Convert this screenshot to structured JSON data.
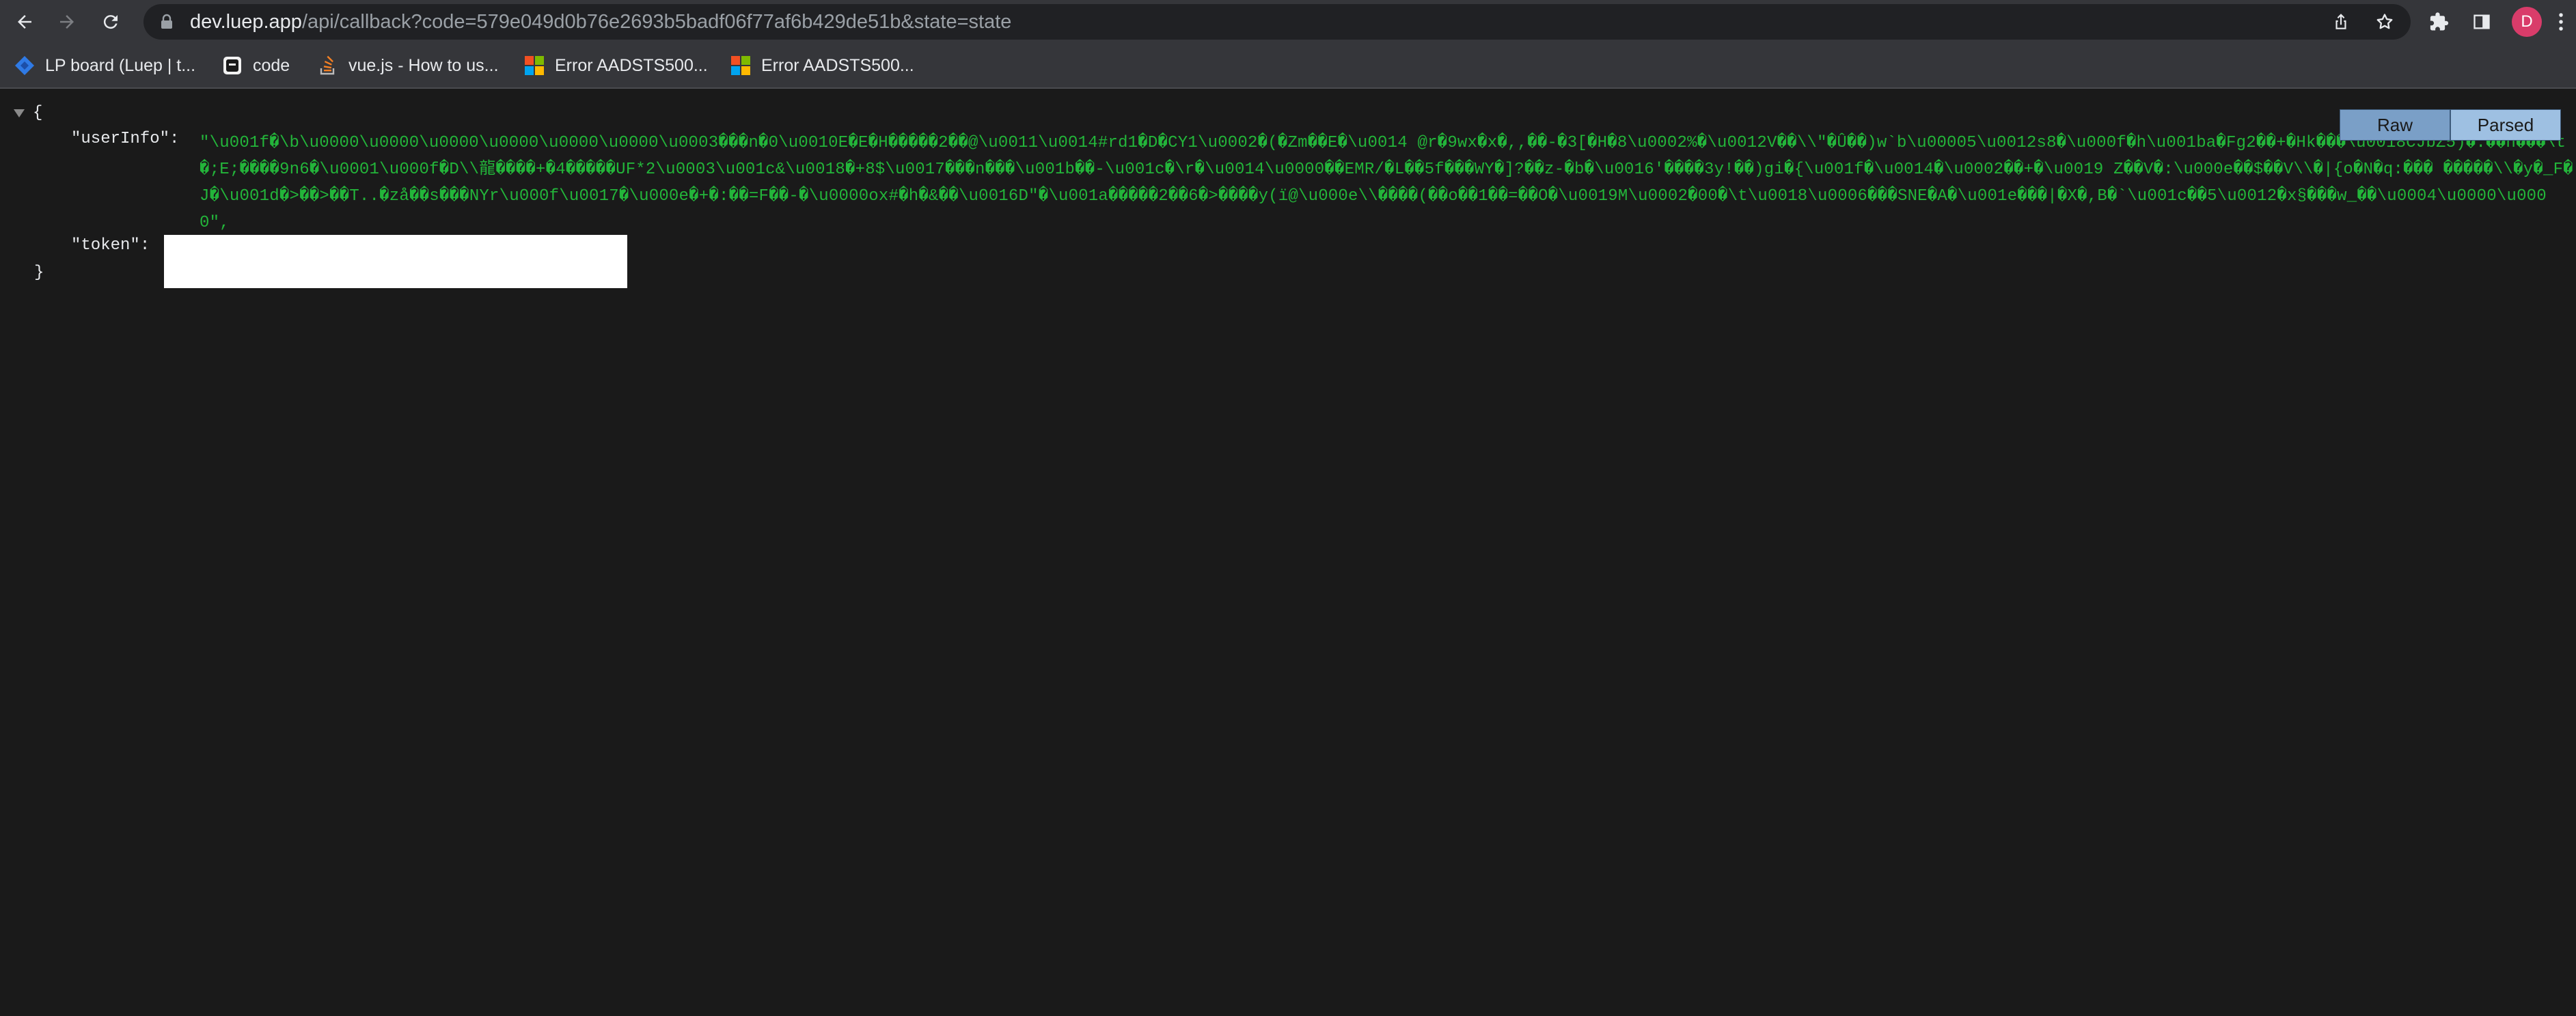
{
  "browser": {
    "url_host": "dev.luep.app",
    "url_rest": "/api/callback?code=579e049d0b76e2693b5badf06f77af6b429de51b&state=state",
    "profile_initial": "D",
    "icons": {
      "back": "back-arrow-icon",
      "forward": "forward-arrow-icon",
      "reload": "reload-icon",
      "lock": "lock-icon",
      "share": "share-icon",
      "bookmark": "star-icon",
      "extensions": "puzzle-icon",
      "side_panel": "side-panel-icon",
      "menu": "kebab-menu-icon"
    }
  },
  "bookmarks": [
    {
      "label": "LP board (Luep | t...",
      "icon": "jira-icon"
    },
    {
      "label": "code",
      "icon": "code-icon"
    },
    {
      "label": "vue.js - How to us...",
      "icon": "stackoverflow-icon"
    },
    {
      "label": "Error AADSTS500...",
      "icon": "microsoft-icon"
    },
    {
      "label": "Error AADSTS500...",
      "icon": "microsoft-icon"
    }
  ],
  "json_view": {
    "open_brace": "{",
    "close_brace": "}",
    "userinfo_key": "\"userInfo\":",
    "userinfo_value": "\"\\u001f�\\b\\u0000\\u0000\\u0000\\u0000\\u0000\\u0000\\u0003���n�0\\u0010E�E�H�����2��@\\u0011\\u0014#rd1�D�CY1\\u0002�(�Zm��E�\\u0014 @r�9wx�x�,,��-�3[�H�8\\u0002%�\\u0012V��\\\\\"�Û��)w`b\\u00005\\u0012s8�\\u000f�h\\u001ba�Fg2��+�Hk���\\u0018CJbZ5)�:��n���\\t�;E;����9n6�\\u0001\\u000f�D\\\\龍����+�4�����UF*2\\u0003\\u001c&\\u0018�+8$\\u0017���n���\\u001b��-\\u001c�\\r�\\u0014\\u0000��EMR/�L��5f���WY�]?��z-�b�\\u0016'����3y!��)gi�{\\u001f�\\u0014�\\u0002��+�\\u0019 Z��V�:\\u000e��$��V\\\\�|{o�N�q:��� �����\\\\�y�_F�J�\\u001d�>��>��T..�zå��s���NYr\\u000f\\u0017�\\u000e�+�:��=F��-�\\u0000ox#�h�&��\\u0016D\"�\\u001a�����2��6�>����y(ï@\\u000e\\\\����(��o��1��=��O�\\u0019M\\u0002�00�\\t\\u0018\\u0006���SNE�A�\\u001e���|�X�,B�`\\u001c��5\\u0012�x§���w_��\\u0004\\u0000\\u0000\",",
    "token_key": "\"token\":"
  },
  "view_toggle": {
    "raw_label": "Raw",
    "parsed_label": "Parsed",
    "selected": "Parsed"
  },
  "colors": {
    "page_bg": "#1a1a1a",
    "string_value": "#23b53a",
    "toggle_selected": "#9ec0e2",
    "toggle_unselected": "#7a9fc7",
    "avatar": "#d93c6a"
  }
}
